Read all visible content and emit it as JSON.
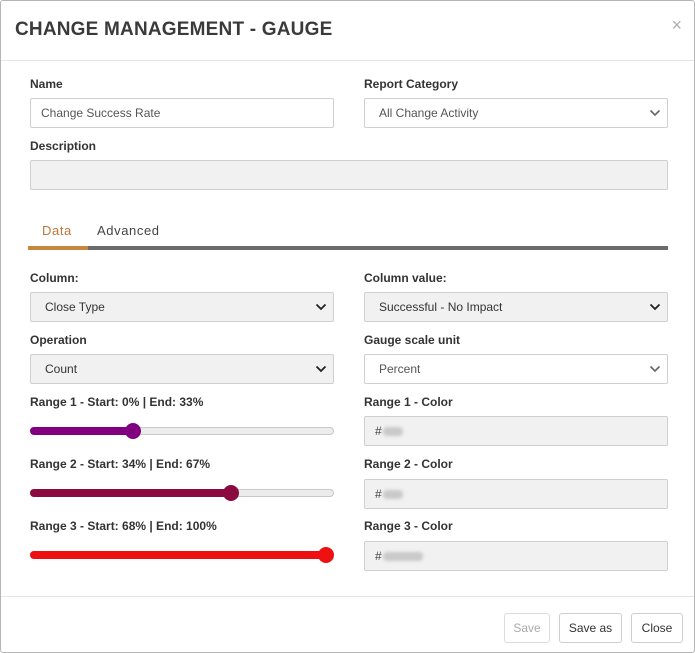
{
  "dialog": {
    "title": "CHANGE MANAGEMENT - GAUGE",
    "close_glyph": "×"
  },
  "form": {
    "name_label": "Name",
    "name_value": "Change Success Rate",
    "report_category_label": "Report Category",
    "report_category_value": "All Change Activity",
    "description_label": "Description",
    "description_value": ""
  },
  "tabs": [
    {
      "label": "Data",
      "active": true
    },
    {
      "label": "Advanced",
      "active": false
    }
  ],
  "data_tab": {
    "column_label": "Column:",
    "column_value": "Close Type",
    "column_value_label": "Column value:",
    "column_value_value": "Successful - No Impact",
    "operation_label": "Operation",
    "operation_value": "Count",
    "gauge_scale_unit_label": "Gauge scale unit",
    "gauge_scale_unit_value": "Percent",
    "ranges": [
      {
        "label": "Range 1 - Start: 0% | End: 33%",
        "level_percent": 33,
        "color": "#800080",
        "color_label": "Range 1 - Color",
        "hash": "#"
      },
      {
        "label": "Range 2 - Start: 34% | End: 67%",
        "level_percent": 67,
        "color": "#8B0A3F",
        "color_label": "Range 2 - Color",
        "hash": "#"
      },
      {
        "label": "Range 3 - Start: 68% | End: 100%",
        "level_percent": 100,
        "color": "#EE1111",
        "color_label": "Range 3 - Color",
        "hash": "#"
      }
    ]
  },
  "footer": {
    "save_label": "Save",
    "save_as_label": "Save as",
    "close_label": "Close"
  },
  "colors": {
    "accent_tab": "#c8873f",
    "tab_line": "#6b6b6b"
  },
  "icons": {
    "close": "close-icon",
    "dropdown": "chevron-down-icon"
  }
}
